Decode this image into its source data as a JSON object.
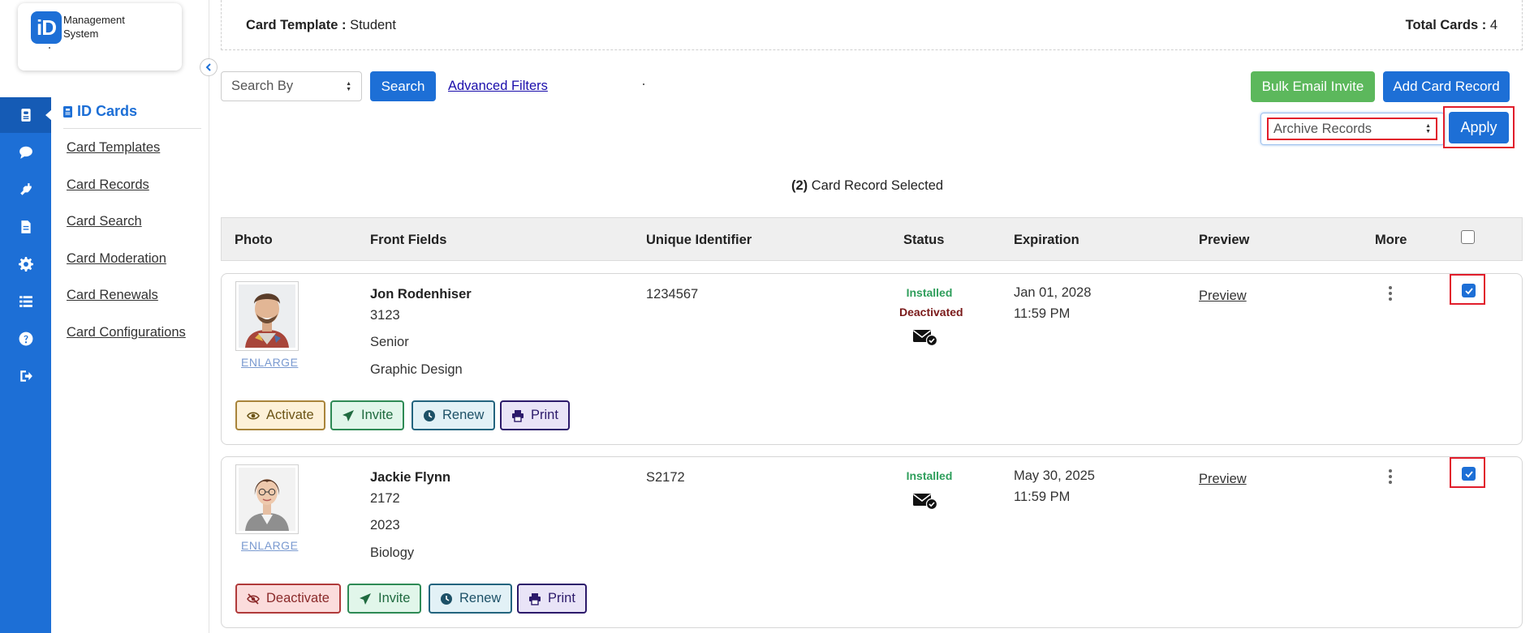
{
  "brand": {
    "badge": "iD",
    "name_line1": "Management",
    "name_line2": "System"
  },
  "rail": {
    "items": [
      "id-card",
      "chat",
      "plug",
      "document",
      "gear",
      "list",
      "help",
      "sign-out"
    ]
  },
  "submenu": {
    "title": "ID Cards",
    "links": [
      "Card Templates",
      "Card Records",
      "Card Search",
      "Card Moderation",
      "Card Renewals",
      "Card Configurations"
    ]
  },
  "header": {
    "template_label": "Card Template :",
    "template_value": "Student",
    "total_label": "Total Cards :",
    "total_value": "4"
  },
  "toolbar": {
    "search_by": "Search By",
    "search_button": "Search",
    "advanced_filters": "Advanced Filters",
    "bulk_email": "Bulk Email Invite",
    "add_record": "Add Card Record",
    "bulk_action": "Archive Records",
    "apply": "Apply"
  },
  "selection": {
    "count": "(2)",
    "text": "Card Record Selected"
  },
  "table": {
    "columns": [
      "Photo",
      "Front Fields",
      "Unique Identifier",
      "Status",
      "Expiration",
      "Preview",
      "More"
    ],
    "rows": [
      {
        "name": "Jon Rodenhiser",
        "fields": [
          "3123",
          "Senior",
          "Graphic Design"
        ],
        "uid": "1234567",
        "status": [
          "Installed",
          "Deactivated"
        ],
        "exp_date": "Jan 01, 2028",
        "exp_time": "11:59 PM",
        "preview": "Preview",
        "enlarge": "ENLARGE",
        "checked": true,
        "actions": [
          "Activate",
          "Invite",
          "Renew",
          "Print"
        ]
      },
      {
        "name": "Jackie Flynn",
        "fields": [
          "2172",
          "2023",
          "Biology"
        ],
        "uid": "S2172",
        "status": [
          "Installed"
        ],
        "exp_date": "May 30, 2025",
        "exp_time": "11:59 PM",
        "preview": "Preview",
        "enlarge": "ENLARGE",
        "checked": true,
        "actions": [
          "Deactivate",
          "Invite",
          "Renew",
          "Print"
        ]
      }
    ]
  },
  "colors": {
    "primary": "#1d6fd6",
    "success": "#5cb85c",
    "highlight": "#e11d2b",
    "installed": "#2e9e5b",
    "deactivated": "#7a1a1a"
  }
}
